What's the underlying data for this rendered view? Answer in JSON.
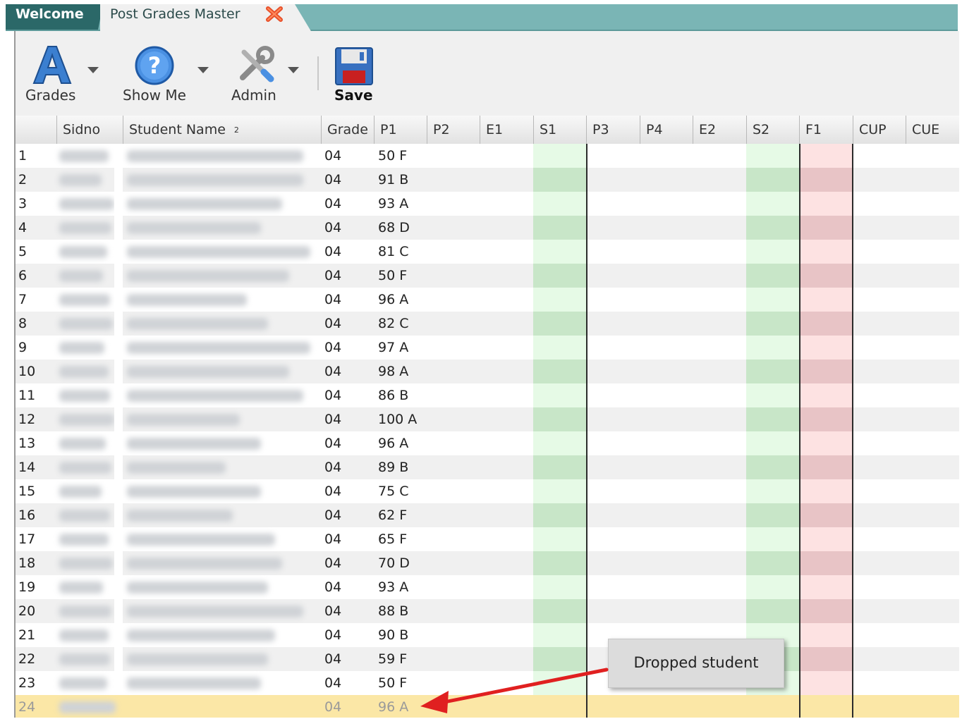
{
  "tabs": [
    {
      "label": "Welcome"
    },
    {
      "label": "Post Grades Master"
    }
  ],
  "toolbar": {
    "grades_label": "Grades",
    "showme_label": "Show Me",
    "admin_label": "Admin",
    "save_label": "Save"
  },
  "columns": [
    "Sidno",
    "Student Name",
    "Grade",
    "P1",
    "P2",
    "E1",
    "S1",
    "P3",
    "P4",
    "E2",
    "S2",
    "F1",
    "CUP",
    "CUE"
  ],
  "sort_indicator": "2",
  "rows": [
    {
      "n": "1",
      "grade": "04",
      "p1": "50 F"
    },
    {
      "n": "2",
      "grade": "04",
      "p1": "91 B"
    },
    {
      "n": "3",
      "grade": "04",
      "p1": "93 A"
    },
    {
      "n": "4",
      "grade": "04",
      "p1": "68 D"
    },
    {
      "n": "5",
      "grade": "04",
      "p1": "81 C"
    },
    {
      "n": "6",
      "grade": "04",
      "p1": "50 F"
    },
    {
      "n": "7",
      "grade": "04",
      "p1": "96 A"
    },
    {
      "n": "8",
      "grade": "04",
      "p1": "82 C"
    },
    {
      "n": "9",
      "grade": "04",
      "p1": "97 A"
    },
    {
      "n": "10",
      "grade": "04",
      "p1": "98 A"
    },
    {
      "n": "11",
      "grade": "04",
      "p1": "86 B"
    },
    {
      "n": "12",
      "grade": "04",
      "p1": "100 A"
    },
    {
      "n": "13",
      "grade": "04",
      "p1": "96 A"
    },
    {
      "n": "14",
      "grade": "04",
      "p1": "89 B"
    },
    {
      "n": "15",
      "grade": "04",
      "p1": "75 C"
    },
    {
      "n": "16",
      "grade": "04",
      "p1": "62 F"
    },
    {
      "n": "17",
      "grade": "04",
      "p1": "65 F"
    },
    {
      "n": "18",
      "grade": "04",
      "p1": "70 D"
    },
    {
      "n": "19",
      "grade": "04",
      "p1": "93 A"
    },
    {
      "n": "20",
      "grade": "04",
      "p1": "88 B"
    },
    {
      "n": "21",
      "grade": "04",
      "p1": "90 B"
    },
    {
      "n": "22",
      "grade": "04",
      "p1": "59 F"
    },
    {
      "n": "23",
      "grade": "04",
      "p1": "50 F"
    },
    {
      "n": "24",
      "grade": "04",
      "p1": "96 A",
      "dropped": true
    }
  ],
  "callout": {
    "text": "Dropped student"
  },
  "colors": {
    "tab_bar": "#7ab5b5",
    "welcome_tab": "#2b6868",
    "s_column_light": "#e6fae6",
    "s_column_dark": "#c8e6c8",
    "f_column_light": "#fde2e2",
    "f_column_dark": "#e8c4c6",
    "dropped_row": "#fbe7a6",
    "arrow": "#e02020"
  }
}
